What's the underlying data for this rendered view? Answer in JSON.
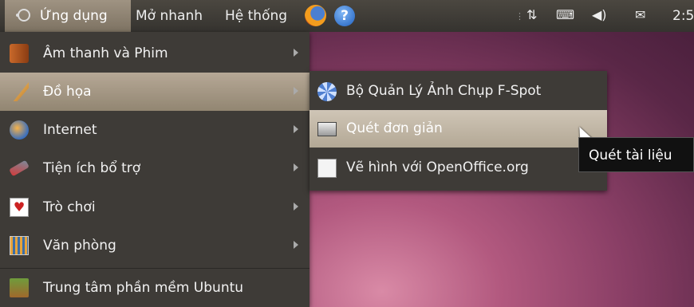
{
  "panel": {
    "applications_label": "Ứng dụng",
    "places_label": "Mở nhanh",
    "system_label": "Hệ thống",
    "clock": "2:5",
    "icons": [
      "ubuntu-logo-icon",
      "firefox-icon",
      "help-icon",
      "network-icon",
      "keyboard-icon",
      "volume-icon",
      "mail-icon"
    ]
  },
  "menu": {
    "items": [
      {
        "label": "Âm thanh và Phim",
        "icon": "audio-video-icon"
      },
      {
        "label": "Đồ họa",
        "icon": "graphics-icon"
      },
      {
        "label": "Internet",
        "icon": "internet-icon"
      },
      {
        "label": "Tiện ích bổ trợ",
        "icon": "accessories-icon"
      },
      {
        "label": "Trò chơi",
        "icon": "games-icon"
      },
      {
        "label": "Văn phòng",
        "icon": "office-icon"
      },
      {
        "label": "Trung tâm phần mềm Ubuntu",
        "icon": "software-center-icon"
      }
    ]
  },
  "submenu": {
    "items": [
      {
        "label": "Bộ Quản Lý Ảnh Chụp F-Spot",
        "icon": "f-spot-icon"
      },
      {
        "label": "Quét đơn giản",
        "icon": "scanner-icon"
      },
      {
        "label": "Vẽ hình với OpenOffice.org",
        "icon": "openoffice-draw-icon"
      }
    ]
  },
  "tooltip": {
    "text": "Quét tài liệu"
  },
  "colors": {
    "panel": "#3d3a35",
    "menu": "#3e3b37",
    "highlight": "#b6a896"
  }
}
